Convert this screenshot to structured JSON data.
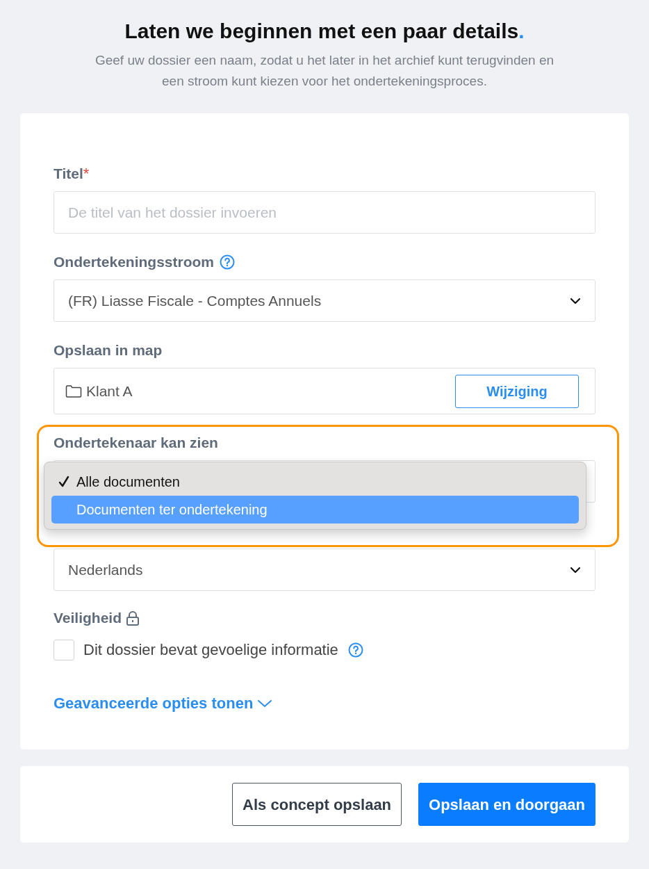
{
  "header": {
    "title": "Laten we beginnen met een paar details",
    "title_mark": ".",
    "subtitle": "Geef uw dossier een naam, zodat u het later in het archief kunt terugvinden en een stroom kunt kiezen voor het ondertekeningsproces."
  },
  "fields": [
    {
      "kind": "text",
      "label": "Titel",
      "required_mark": "*",
      "placeholder": "De titel van het dossier invoeren"
    },
    {
      "kind": "select",
      "label": "Ondertekeningsstroom",
      "help": true,
      "value": "(FR) Liasse Fiscale - Comptes Annuels"
    },
    {
      "kind": "folder",
      "label": "Opslaan in map",
      "value": "Klant A",
      "button": "Wijziging"
    },
    {
      "kind": "select",
      "label": "Ondertekenaar kan zien",
      "highlighted": true,
      "menu_open": true,
      "options": [
        {
          "label": "Alle documenten",
          "checked": true,
          "selected": false
        },
        {
          "label": "Documenten ter ondertekening",
          "checked": false,
          "selected": true
        }
      ]
    },
    {
      "kind": "select",
      "value": "Nederlands"
    }
  ],
  "security": {
    "label": "Veiligheid",
    "checkbox": {
      "label": "Dit dossier bevat gevoelige informatie",
      "checked": false
    }
  },
  "advanced_link": "Geavanceerde opties tonen",
  "buttons": [
    {
      "label": "Als concept opslaan",
      "kind": "secondary"
    },
    {
      "label": "Opslaan en doorgaan",
      "kind": "primary"
    }
  ]
}
